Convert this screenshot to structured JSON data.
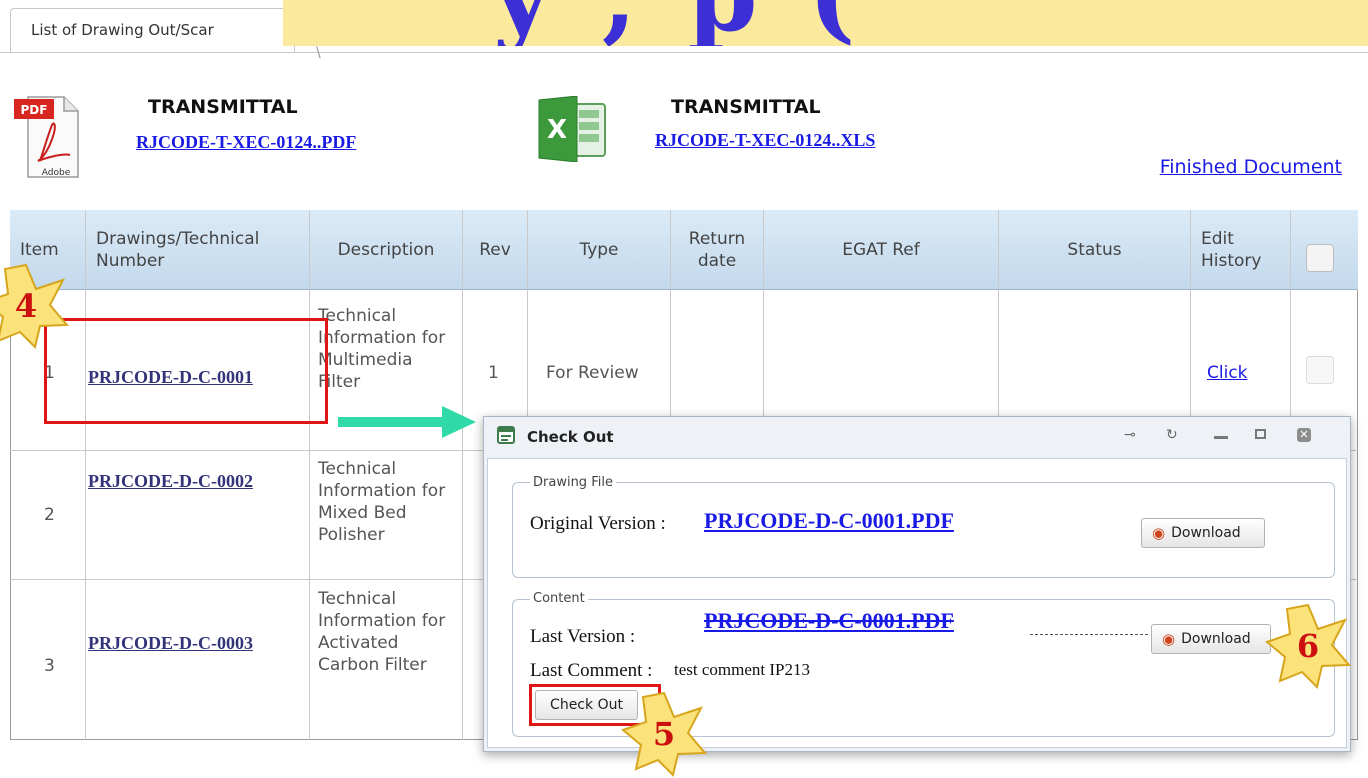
{
  "tab": {
    "label": "List of Drawing Out/Scar"
  },
  "banner": {
    "text": "y , p ("
  },
  "transmittal_pdf": {
    "title": "TRANSMITTAL",
    "link": "RJCODE-T-XEC-0124..PDF",
    "icon_label": "PDF",
    "icon_sub": "Adobe"
  },
  "transmittal_xls": {
    "title": "TRANSMITTAL",
    "link": "RJCODE-T-XEC-0124..XLS"
  },
  "finished_document": "Finished Document",
  "table": {
    "headers": {
      "item": "Item",
      "number": "Drawings/Technical Number",
      "description": "Description",
      "rev": "Rev",
      "type": "Type",
      "return_date": "Return date",
      "egat_ref": "EGAT Ref",
      "status": "Status",
      "edit_history": "Edit History"
    },
    "rows": [
      {
        "item": "1",
        "number": "PRJCODE-D-C-0001",
        "description": "Technical Information for Multimedia Filter",
        "rev": "1",
        "type": "For Review",
        "edit": "Click"
      },
      {
        "item": "2",
        "number": "PRJCODE-D-C-0002",
        "description": "Technical Information for Mixed Bed Polisher"
      },
      {
        "item": "3",
        "number": "PRJCODE-D-C-0003",
        "description": "Technical Information for Activated Carbon Filter"
      }
    ]
  },
  "dialog": {
    "title": "Check Out",
    "drawing_file": {
      "legend": "Drawing File",
      "label": "Original Version :",
      "file": "PRJCODE-D-C-0001.PDF",
      "download": "Download"
    },
    "content": {
      "legend": "Content",
      "last_version_label": "Last Version :",
      "last_version_file": "PRJCODE-D-C-0001.PDF",
      "download": "Download",
      "last_comment_label": "Last Comment :",
      "last_comment": "test comment IP213",
      "checkout_button": "Check Out"
    }
  },
  "badges": {
    "step4": "4",
    "step5": "5",
    "step6": "6"
  },
  "colors": {
    "annotation_red": "#e01515",
    "arrow": "#2fd9a8",
    "badge_fill": "#fbe27a",
    "link_blue": "#1a1ae6"
  }
}
